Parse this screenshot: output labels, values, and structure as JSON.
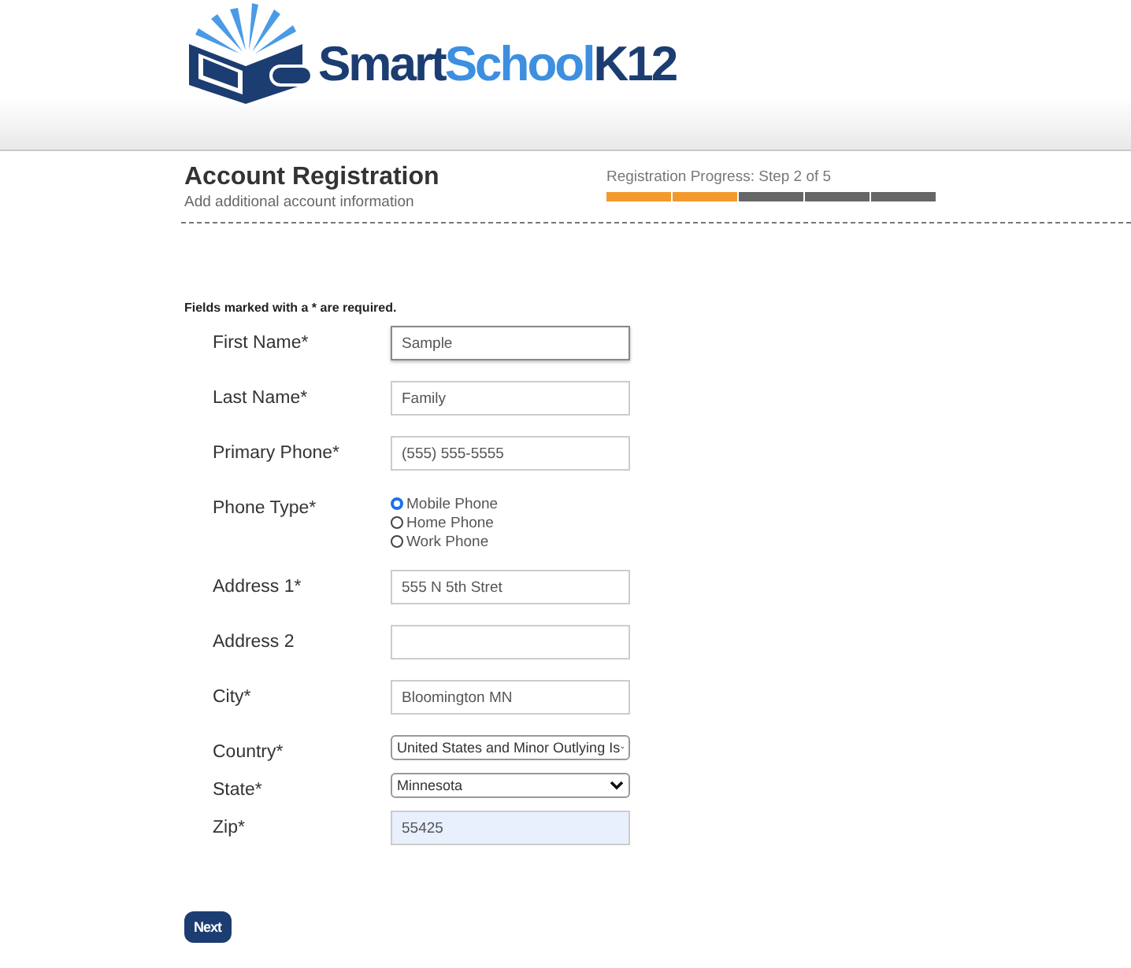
{
  "logo": {
    "parts": [
      {
        "text": "Smart",
        "color": "#1c3d72"
      },
      {
        "text": "School",
        "color": "#3d8fe0"
      },
      {
        "text": "K12",
        "color": "#1c3d72"
      }
    ]
  },
  "header": {
    "title": "Account Registration",
    "subtitle": "Add additional account information",
    "progress_label": "Registration Progress: Step 2 of 5",
    "steps": [
      {
        "complete": true
      },
      {
        "complete": true
      },
      {
        "complete": false
      },
      {
        "complete": false
      },
      {
        "complete": false
      }
    ]
  },
  "required_note": "Fields marked with a * are required.",
  "fields": [
    {
      "kind": "text",
      "label": "First Name*",
      "value": "Sample",
      "focused": true,
      "autofilled": false
    },
    {
      "kind": "text",
      "label": "Last Name*",
      "value": "Family",
      "focused": false,
      "autofilled": false
    },
    {
      "kind": "text",
      "label": "Primary Phone*",
      "value": "(555) 555-5555",
      "focused": false,
      "autofilled": false
    },
    {
      "kind": "radio",
      "label": "Phone Type*",
      "options": [
        {
          "label": "Mobile Phone",
          "selected": true
        },
        {
          "label": "Home Phone",
          "selected": false
        },
        {
          "label": "Work Phone",
          "selected": false
        }
      ]
    },
    {
      "kind": "text",
      "label": "Address 1*",
      "value": "555 N 5th Stret",
      "focused": false,
      "autofilled": false
    },
    {
      "kind": "text",
      "label": "Address 2",
      "focused": false,
      "autofilled": false
    },
    {
      "kind": "text",
      "label": "City*",
      "value": "Bloomington MN",
      "focused": false,
      "autofilled": false
    },
    {
      "kind": "select",
      "label": "Country*",
      "value": "United States and Minor Outlying Is"
    },
    {
      "kind": "select",
      "label": "State*",
      "value": "Minnesota"
    },
    {
      "kind": "text",
      "label": "Zip*",
      "value": "55425",
      "focused": false,
      "autofilled": true
    }
  ],
  "buttons": [
    {
      "label": "Next"
    }
  ]
}
